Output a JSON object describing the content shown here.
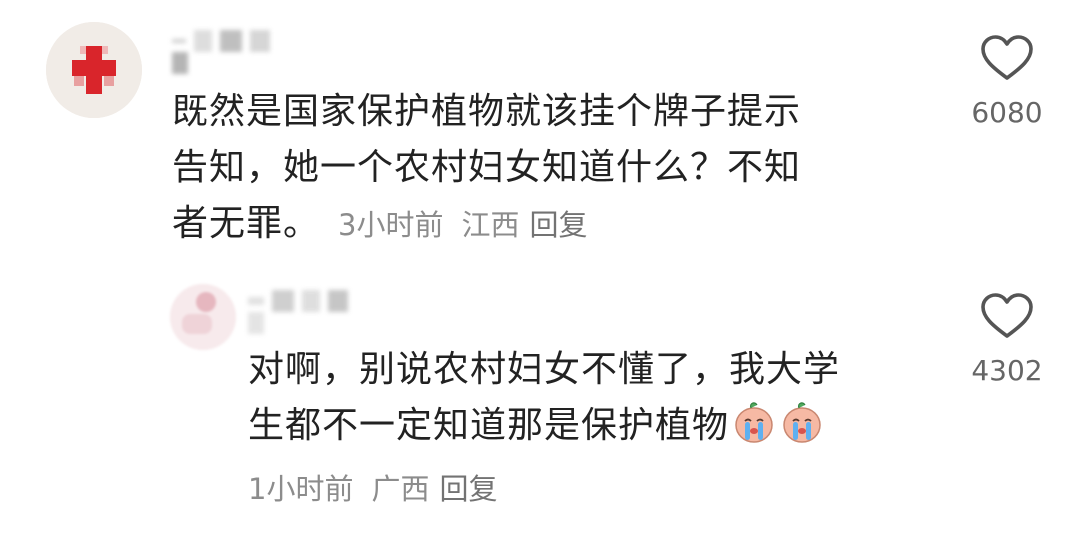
{
  "comments": [
    {
      "text_lines": [
        "既然是国家保护植物就该挂个牌子提示",
        "告知，她一个农村妇女知道什么？不知",
        "者无罪。"
      ],
      "time": "3小时前",
      "location": "江西",
      "reply_label": "回复",
      "likes": "6080",
      "avatar_icon": "red-cross-icon"
    },
    {
      "text_lines": [
        "对啊，别说农村妇女不懂了，我大学",
        "生都不一定知道那是保护植物"
      ],
      "emojis": [
        "crying-face-emoji",
        "crying-face-emoji"
      ],
      "time": "1小时前",
      "location": "广西",
      "reply_label": "回复",
      "likes": "4302"
    }
  ],
  "colors": {
    "text": "#222222",
    "meta": "#8c8c8c",
    "avatar_cross": "#d9252b"
  }
}
